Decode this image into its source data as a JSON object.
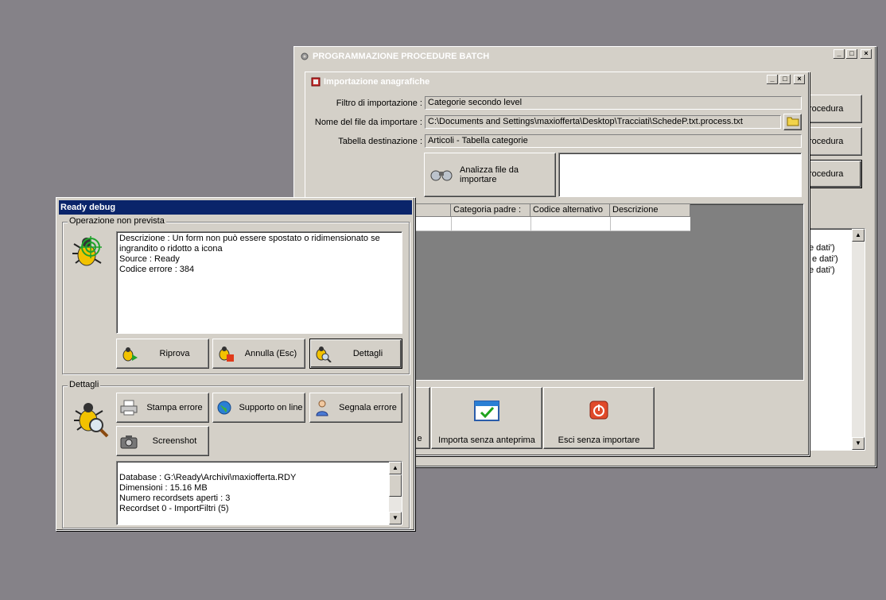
{
  "batch_window": {
    "title": "PROGRAMMAZIONE PROCEDURE BATCH",
    "side_buttons": [
      "rocedura",
      "rocedura",
      "rocedura"
    ],
    "log_lines": [
      "e dati')",
      "e dati')",
      "e dati')"
    ]
  },
  "import_window": {
    "title": "Importazione anagrafiche",
    "filter_label": "Filtro di importazione :",
    "filter_value": "Categorie secondo level",
    "file_label": "Nome del file da importare :",
    "file_value": "C:\\Documents and Settings\\maxiofferta\\Desktop\\Tracciati\\SchedeP.txt.process.txt",
    "dest_label": "Tabella destinazione :",
    "dest_value": "Articoli - Tabella categorie",
    "analyze_button": "Analizza file da importare",
    "columns": [
      "Categoria padre :",
      "Codice alternativo",
      "Descrizione"
    ],
    "bottom_buttons": {
      "partial": "e",
      "import_no_preview": "Importa senza anteprima",
      "exit_no_import": "Esci senza importare"
    }
  },
  "debug_window": {
    "title": "Ready debug",
    "group_error": "Operazione non prevista",
    "error_text": "Descrizione : Un form non può essere spostato o ridimensionato se ingrandito o ridotto a icona\nSource : Ready\nCodice errore : 384",
    "buttons": {
      "retry": "Riprova",
      "cancel": "Annulla (Esc)",
      "details": "Dettagli"
    },
    "group_details": "Dettagli",
    "detail_buttons": {
      "print": "Stampa errore",
      "support": "Supporto on line",
      "report": "Segnala errore",
      "screenshot": "Screenshot"
    },
    "details_text": "Database : G:\\Ready\\Archivi\\maxiofferta.RDY\nDimensioni : 15.16 MB\nNumero recordsets aperti : 3\nRecordset 0 - ImportFiltri (5)"
  },
  "colors": {
    "desktop": "#858288",
    "face": "#d4d0c8",
    "active_title": "#0a246a"
  }
}
